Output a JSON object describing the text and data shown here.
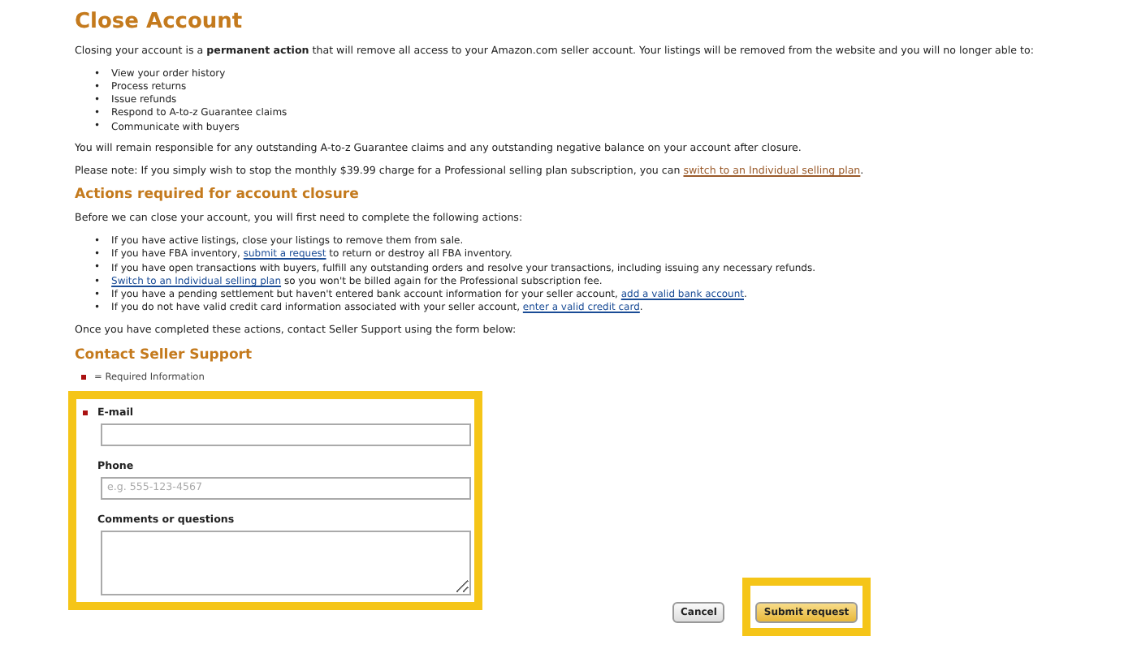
{
  "title": "Close Account",
  "intro": [
    {
      "kind": "plain",
      "text": "Closing your account is a **permanent action** that will remove all access to your Amazon.com seller account. Your listings will be removed from the website and you will no longer able to:"
    }
  ],
  "bullet": "•",
  "losses": [
    [
      {
        "kind": "plain",
        "text": "View your order history"
      }
    ],
    [
      {
        "kind": "plain",
        "text": "Process returns"
      }
    ],
    [
      {
        "kind": "plain",
        "text": "Issue refunds"
      }
    ],
    [
      {
        "kind": "plain",
        "text": "Respond to A-to-z Guarantee claims"
      }
    ],
    [
      {
        "kind": "plain",
        "text": "Communicate with buyers"
      }
    ]
  ],
  "responsibility": [
    {
      "kind": "plain",
      "text": "You will remain responsible for any outstanding A-to-z Guarantee claims and any outstanding negative balance on your account after closure."
    }
  ],
  "note": [
    {
      "kind": "plain",
      "text": "Please note: If you simply wish to stop the monthly $39.99 charge for a Professional selling plan subscription, you can "
    },
    {
      "kind": "link",
      "text": "switch to an Individual selling plan"
    },
    {
      "kind": "plain",
      "text": "."
    }
  ],
  "actions_heading": "Actions required for account closure",
  "actions_intro": [
    {
      "kind": "plain",
      "text": "Before we can close your account, you will first need to complete the following actions:"
    }
  ],
  "actions": [
    [
      {
        "kind": "plain",
        "text": "If you have active listings, close your listings to remove them from sale."
      }
    ],
    [
      {
        "kind": "plain",
        "text": "If you have FBA inventory, "
      },
      {
        "kind": "link",
        "text": "submit a request"
      },
      {
        "kind": "plain",
        "text": " to return or destroy all FBA inventory."
      }
    ],
    [
      {
        "kind": "plain",
        "text": "If you have open transactions with buyers, fulfill any outstanding orders and resolve your transactions, including issuing any necessary refunds."
      }
    ],
    [
      {
        "kind": "link",
        "text": "Switch to an Individual selling plan"
      },
      {
        "kind": "plain",
        "text": " so you won't be billed again for the Professional subscription fee."
      }
    ],
    [
      {
        "kind": "plain",
        "text": "If you have a pending settlement but haven't entered bank account information for your seller account, "
      },
      {
        "kind": "link",
        "text": "add a valid bank account"
      },
      {
        "kind": "plain",
        "text": "."
      }
    ],
    [
      {
        "kind": "plain",
        "text": "If you do not have valid credit card information associated with your seller account, "
      },
      {
        "kind": "link",
        "text": "enter a valid credit card"
      },
      {
        "kind": "plain",
        "text": "."
      }
    ]
  ],
  "outro": [
    {
      "kind": "plain",
      "text": "Once you have completed these actions, contact Seller Support using the form below:"
    }
  ],
  "contact_heading": "Contact Seller Support",
  "required_legend": "= Required Information",
  "form": {
    "highlighted": true,
    "fields": [
      {
        "label": "E-mail",
        "kind": "input",
        "required": true
      },
      {
        "label": "Phone",
        "kind": "input",
        "required": false,
        "placeholder": "e.g. 555-123-4567"
      },
      {
        "label": "Comments or questions",
        "kind": "textarea",
        "required": false
      }
    ]
  },
  "buttons": [
    {
      "label": "Cancel",
      "primary": false,
      "highlighted": false
    },
    {
      "label": "Submit request",
      "primary": true,
      "highlighted": true
    }
  ]
}
